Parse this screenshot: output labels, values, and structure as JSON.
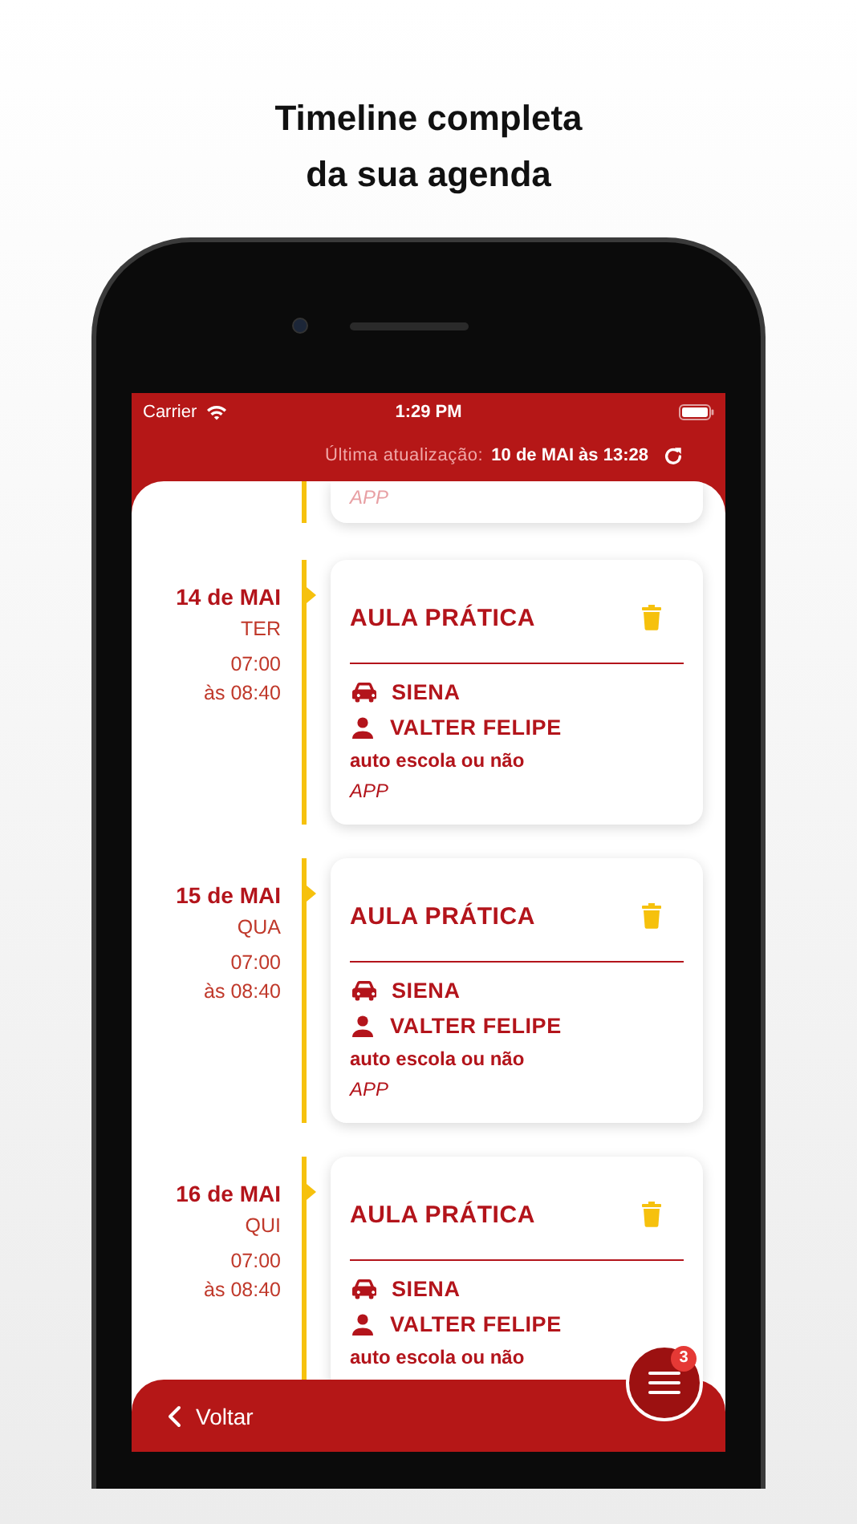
{
  "headline_lines": [
    "Timeline completa",
    "da sua agenda"
  ],
  "status_bar": {
    "carrier": "Carrier",
    "time": "1:29 PM"
  },
  "header": {
    "label": "Última atualização:",
    "value": "10 de MAI às 13:28"
  },
  "timeline": [
    {
      "note": "APP"
    },
    {
      "date": "14 de MAI",
      "weekday": "TER",
      "start": "07:00",
      "end": "às 08:40",
      "title": "AULA PRÁTICA",
      "vehicle": "SIENA",
      "instructor": "VALTER FELIPE",
      "description": "auto escola ou não",
      "note": "APP"
    },
    {
      "date": "15 de MAI",
      "weekday": "QUA",
      "start": "07:00",
      "end": "às 08:40",
      "title": "AULA PRÁTICA",
      "vehicle": "SIENA",
      "instructor": "VALTER FELIPE",
      "description": "auto escola ou não",
      "note": "APP"
    },
    {
      "date": "16 de MAI",
      "weekday": "QUI",
      "start": "07:00",
      "end": "às 08:40",
      "title": "AULA PRÁTICA",
      "vehicle": "SIENA",
      "instructor": "VALTER FELIPE",
      "description": "auto escola ou não"
    }
  ],
  "back_button": {
    "label": "Voltar"
  },
  "menu_button": {
    "badge": "3"
  }
}
